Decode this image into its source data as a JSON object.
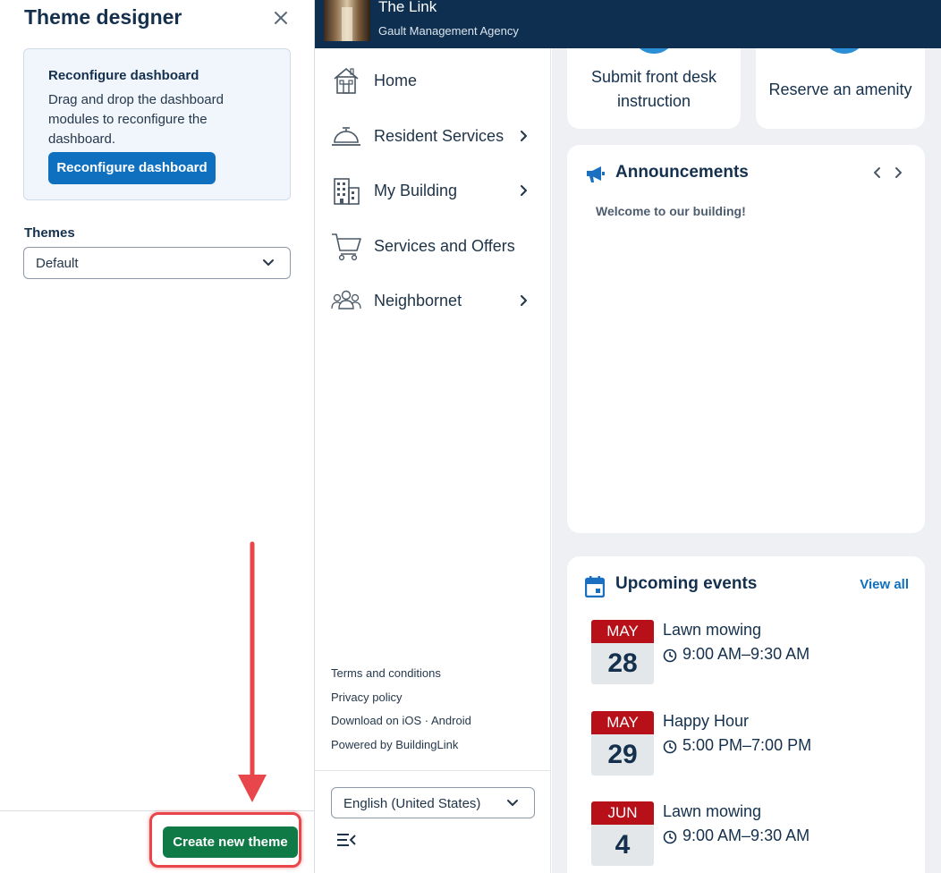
{
  "designer": {
    "title": "Theme designer",
    "reconfigure_card": {
      "title": "Reconfigure dashboard",
      "description": "Drag and drop the dashboard modules to reconfigure the dashboard.",
      "button_label": "Reconfigure dashboard"
    },
    "themes_label": "Themes",
    "themes_selected": "Default",
    "create_button_label": "Create new theme"
  },
  "header": {
    "building_name": "The Link",
    "agency": "Gault Management Agency"
  },
  "nav": {
    "items": [
      {
        "label": "Home",
        "icon": "home-icon",
        "has_submenu": false
      },
      {
        "label": "Resident Services",
        "icon": "service-bell-icon",
        "has_submenu": true
      },
      {
        "label": "My Building",
        "icon": "building-icon",
        "has_submenu": true
      },
      {
        "label": "Services and Offers",
        "icon": "shopping-cart-icon",
        "has_submenu": false
      },
      {
        "label": "Neighbornet",
        "icon": "people-group-icon",
        "has_submenu": true
      }
    ],
    "links": [
      "Terms and conditions",
      "Privacy policy",
      "Download on iOS · Android",
      "Powered by BuildingLink"
    ],
    "language": "English (United States)"
  },
  "quick_actions": [
    {
      "label": "Submit front desk instruction"
    },
    {
      "label": "Reserve an amenity"
    }
  ],
  "announcements": {
    "title": "Announcements",
    "message": "Welcome to our building!"
  },
  "events": {
    "title": "Upcoming events",
    "view_all": "View all",
    "items": [
      {
        "month": "MAY",
        "day": "28",
        "name": "Lawn mowing",
        "time": "9:00 AM–9:30 AM"
      },
      {
        "month": "MAY",
        "day": "29",
        "name": "Happy Hour",
        "time": "5:00 PM–7:00 PM"
      },
      {
        "month": "JUN",
        "day": "4",
        "name": "Lawn mowing",
        "time": "9:00 AM–9:30 AM"
      }
    ]
  },
  "colors": {
    "header_bg": "#0e2f4f",
    "primary_button": "#1070c0",
    "create_button": "#107a47",
    "highlight": "#e8464a",
    "calendar_month": "#b71018"
  }
}
